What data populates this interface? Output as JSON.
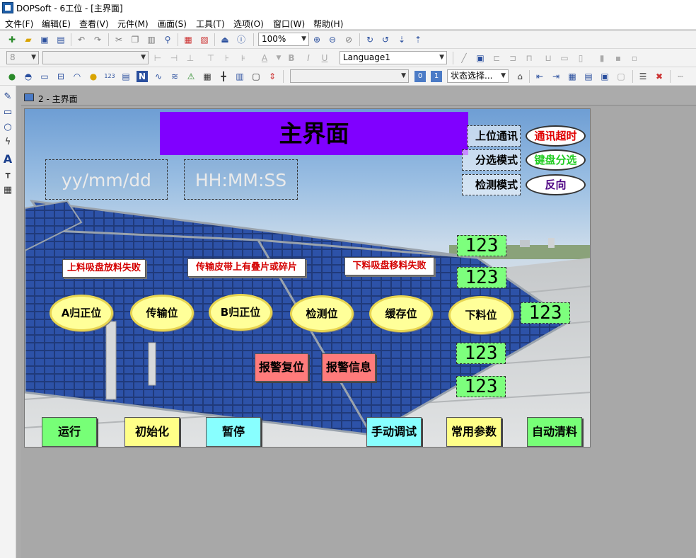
{
  "window": {
    "title": "DOPSoft - 6工位 - [主界面]"
  },
  "menu": [
    "文件(F)",
    "编辑(E)",
    "查看(V)",
    "元件(M)",
    "画面(S)",
    "工具(T)",
    "选项(O)",
    "窗口(W)",
    "帮助(H)"
  ],
  "toolbar1": {
    "zoom": "100%"
  },
  "toolbar2": {
    "font_size": "8",
    "font_name": "",
    "language": "Language1"
  },
  "toolbar3": {
    "state_select": "状态选择..."
  },
  "document_tab": {
    "label": "2 - 主界面"
  },
  "hmi": {
    "title": "主界面",
    "date_placeholder": "yy/mm/dd",
    "time_placeholder": "HH:MM:SS",
    "status_rows": [
      {
        "label": "上位通讯",
        "value": "通讯超时",
        "color": "#e00000"
      },
      {
        "label": "分选模式",
        "value": "键盘分选",
        "color": "#22cc22"
      },
      {
        "label": "检测模式",
        "value": "反向",
        "color": "#4b0082"
      }
    ],
    "alarms": [
      "上料吸盘放料失败",
      "传输皮带上有叠片或碎片",
      "下料吸盘移料失败"
    ],
    "stations": [
      "A归正位",
      "传输位",
      "B归正位",
      "检测位",
      "缓存位",
      "下料位"
    ],
    "numeric_displays": [
      "123",
      "123",
      "123",
      "123",
      "123"
    ],
    "unload_numeric": "123",
    "alarm_buttons": {
      "reset": "报警复位",
      "info": "报警信息"
    },
    "bottom_buttons": {
      "run": "运行",
      "init": "初始化",
      "pause": "暂停",
      "manual": "手动调试",
      "params": "常用参数",
      "clean": "自动清料"
    }
  }
}
